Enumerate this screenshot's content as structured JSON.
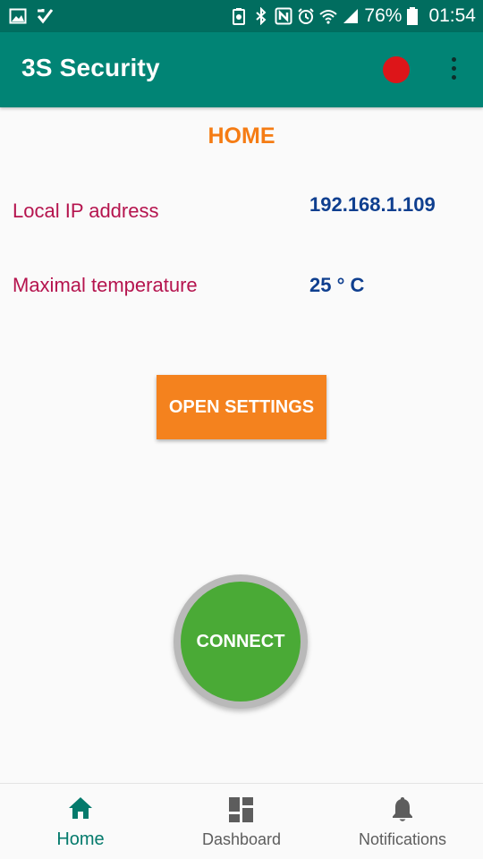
{
  "status_bar": {
    "battery": "76%",
    "time": "01:54",
    "icons": [
      "gallery-icon",
      "checkmark-icon",
      "battery-saver-icon",
      "bluetooth-icon",
      "nfc-icon",
      "alarm-icon",
      "wifi-icon",
      "signal-icon",
      "battery-icon"
    ]
  },
  "app_bar": {
    "title": "3S Security",
    "status_color": "#dd1519"
  },
  "home": {
    "title": "HOME",
    "ip_label": "Local IP address",
    "ip_value": "192.168.1.109",
    "temp_label": "Maximal temperature",
    "temp_value": "25 ° C",
    "settings_label": "OPEN SETTINGS",
    "connect_label": "CONNECT"
  },
  "bottom_nav": {
    "items": [
      {
        "label": "Home",
        "icon": "home-icon",
        "active": true
      },
      {
        "label": "Dashboard",
        "icon": "dashboard-icon",
        "active": false
      },
      {
        "label": "Notifications",
        "icon": "bell-icon",
        "active": false
      }
    ]
  },
  "colors": {
    "primary": "#018475",
    "primary_dark": "#016d5f",
    "accent_orange": "#f4821e",
    "label_red": "#b5144e",
    "value_blue": "#0f3f8f",
    "connect_green": "#4aaa36"
  }
}
